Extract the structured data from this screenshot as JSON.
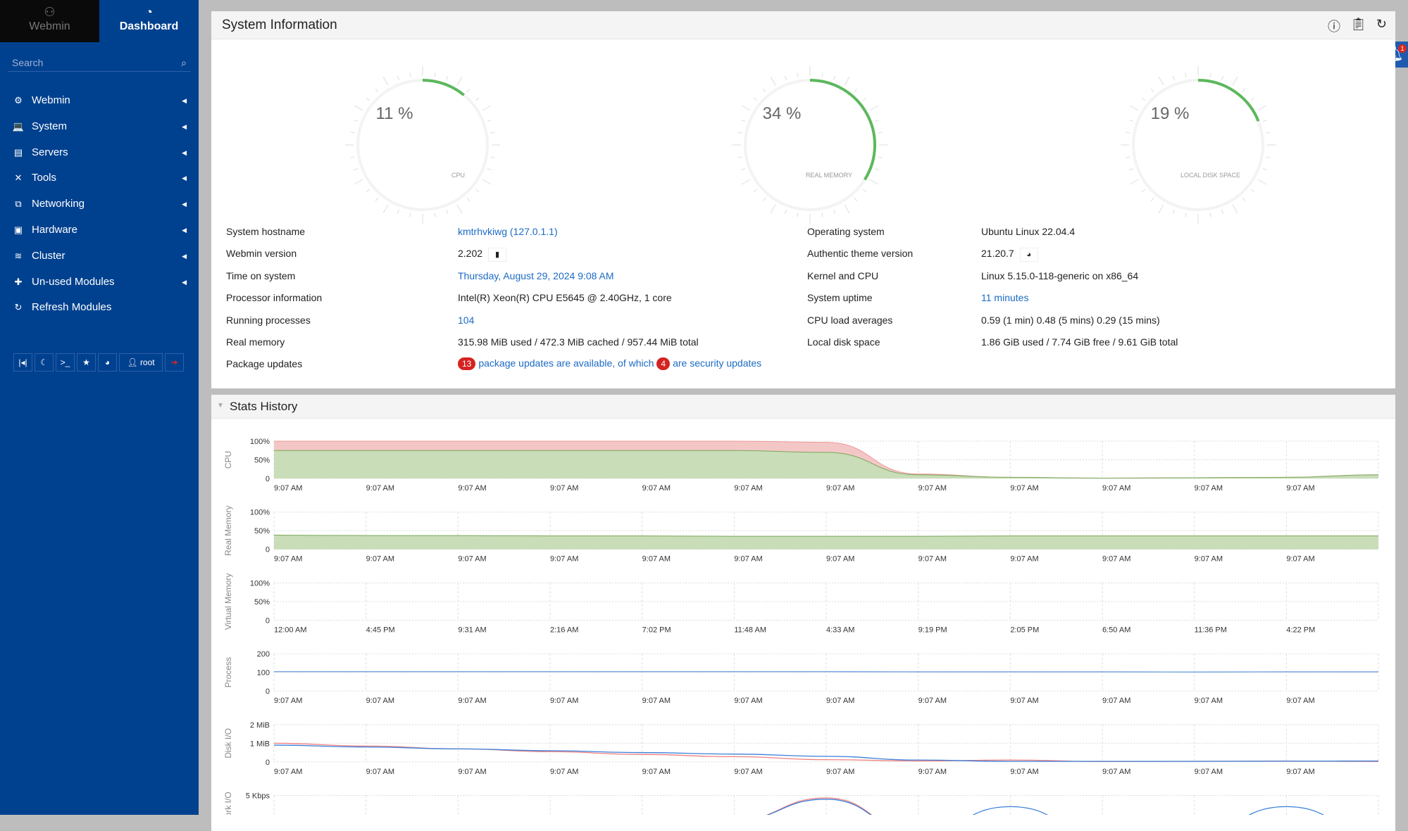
{
  "sidebar": {
    "brand_label": "Webmin",
    "dashboard_label": "Dashboard",
    "search_placeholder": "Search",
    "items": [
      {
        "label": "Webmin",
        "icon": "gear-icon",
        "glyph": "⚙",
        "has_submenu": true
      },
      {
        "label": "System",
        "icon": "laptop-icon",
        "glyph": "💻",
        "has_submenu": true
      },
      {
        "label": "Servers",
        "icon": "server-icon",
        "glyph": "▤",
        "has_submenu": true
      },
      {
        "label": "Tools",
        "icon": "tools-icon",
        "glyph": "✕",
        "has_submenu": true
      },
      {
        "label": "Networking",
        "icon": "network-icon",
        "glyph": "⧉",
        "has_submenu": true
      },
      {
        "label": "Hardware",
        "icon": "hdd-icon",
        "glyph": "▣",
        "has_submenu": true
      },
      {
        "label": "Cluster",
        "icon": "layers-icon",
        "glyph": "≋",
        "has_submenu": true
      },
      {
        "label": "Un-used Modules",
        "icon": "puzzle-icon",
        "glyph": "✚",
        "has_submenu": true
      },
      {
        "label": "Refresh Modules",
        "icon": "refresh-icon",
        "glyph": "↻",
        "has_submenu": false
      }
    ],
    "bottom_buttons": [
      {
        "name": "collapse-button",
        "icon": "collapse-icon",
        "glyph": "|◂|"
      },
      {
        "name": "night-mode-button",
        "icon": "moon-icon",
        "glyph": "☾"
      },
      {
        "name": "terminal-button",
        "icon": "terminal-icon",
        "glyph": ">_"
      },
      {
        "name": "favorites-button",
        "icon": "star-icon",
        "glyph": "★"
      },
      {
        "name": "theme-button",
        "icon": "palette-icon",
        "glyph": "◕"
      },
      {
        "name": "user-button",
        "icon": "user-cog-icon",
        "glyph": "👤 root",
        "label": "root"
      },
      {
        "name": "logout-button",
        "icon": "logout-icon",
        "glyph": "➜",
        "color": "#e0241b"
      }
    ]
  },
  "notifications": {
    "count": "1"
  },
  "system_info": {
    "title": "System Information",
    "header_icons": [
      "help-icon",
      "clipboard-icon",
      "refresh-icon"
    ],
    "gauges": [
      {
        "label": "CPU",
        "percent": 11
      },
      {
        "label": "REAL MEMORY",
        "percent": 34
      },
      {
        "label": "LOCAL DISK SPACE",
        "percent": 19
      }
    ],
    "gauge_color": "#5cb85c",
    "left": [
      {
        "label": "System hostname",
        "value": "kmtrhvkiwg (127.0.1.1)",
        "link": true
      },
      {
        "label": "Webmin version",
        "value": "2.202",
        "icon": "book-icon"
      },
      {
        "label": "Time on system",
        "value": "Thursday, August 29, 2024 9:08 AM",
        "link": true
      },
      {
        "label": "Processor information",
        "value": "Intel(R) Xeon(R) CPU E5645 @ 2.40GHz, 1 core"
      },
      {
        "label": "Running processes",
        "value": "104",
        "link": true
      },
      {
        "label": "Real memory",
        "value": "315.98 MiB used / 472.3 MiB cached / 957.44 MiB total"
      }
    ],
    "package_updates": {
      "label": "Package updates",
      "count": "13",
      "text1": "package updates are available, of which",
      "security_count": "4",
      "text2": "are security updates"
    },
    "right": [
      {
        "label": "Operating system",
        "value": "Ubuntu Linux 22.04.4"
      },
      {
        "label": "Authentic theme version",
        "value": "21.20.7",
        "icon": "palette-icon"
      },
      {
        "label": "Kernel and CPU",
        "value": "Linux 5.15.0-118-generic on x86_64"
      },
      {
        "label": "System uptime",
        "value": "11 minutes",
        "link": true
      },
      {
        "label": "CPU load averages",
        "value": "0.59 (1 min) 0.48 (5 mins) 0.29 (15 mins)"
      },
      {
        "label": "Local disk space",
        "value": "1.86 GiB used / 7.74 GiB free / 9.61 GiB total"
      }
    ]
  },
  "stats_history": {
    "title": "Stats History"
  },
  "chart_data": [
    {
      "type": "area",
      "ylabel": "CPU",
      "yticks": [
        "100%",
        "50%",
        "0"
      ],
      "ylim": [
        0,
        100
      ],
      "grid": true,
      "xticks": [
        "9:07 AM",
        "9:07 AM",
        "9:07 AM",
        "9:07 AM",
        "9:07 AM",
        "9:07 AM",
        "9:07 AM",
        "9:07 AM",
        "9:07 AM",
        "9:07 AM",
        "9:07 AM",
        "9:07 AM"
      ],
      "series": [
        {
          "color": "#f4c7c7",
          "values": [
            100,
            100,
            100,
            100,
            100,
            100,
            97,
            12,
            3,
            1,
            2,
            3,
            10
          ]
        },
        {
          "color": "#c9ddb8",
          "values": [
            75,
            75,
            75,
            75,
            75,
            75,
            70,
            10,
            3,
            1,
            2,
            3,
            10
          ]
        }
      ]
    },
    {
      "type": "area",
      "ylabel": "Real Memory",
      "yticks": [
        "100%",
        "50%",
        "0"
      ],
      "ylim": [
        0,
        100
      ],
      "grid": true,
      "xticks": [
        "9:07 AM",
        "9:07 AM",
        "9:07 AM",
        "9:07 AM",
        "9:07 AM",
        "9:07 AM",
        "9:07 AM",
        "9:07 AM",
        "9:07 AM",
        "9:07 AM",
        "9:07 AM",
        "9:07 AM"
      ],
      "series": [
        {
          "color": "#c9ddb8",
          "values": [
            38,
            37,
            37,
            36,
            36,
            35,
            35,
            35,
            36,
            36,
            36,
            36,
            36
          ]
        }
      ]
    },
    {
      "type": "area",
      "ylabel": "Virtual Memory",
      "yticks": [
        "100%",
        "50%",
        "0"
      ],
      "ylim": [
        0,
        100
      ],
      "grid": true,
      "xticks": [
        "12:00 AM",
        "4:45 PM",
        "9:31 AM",
        "2:16 AM",
        "7:02 PM",
        "11:48 AM",
        "4:33 AM",
        "9:19 PM",
        "2:05 PM",
        "6:50 AM",
        "11:36 PM",
        "4:22 PM"
      ],
      "series": []
    },
    {
      "type": "line",
      "ylabel": "Process",
      "yticks": [
        "200",
        "100",
        "0"
      ],
      "ylim": [
        0,
        200
      ],
      "grid": true,
      "xticks": [
        "9:07 AM",
        "9:07 AM",
        "9:07 AM",
        "9:07 AM",
        "9:07 AM",
        "9:07 AM",
        "9:07 AM",
        "9:07 AM",
        "9:07 AM",
        "9:07 AM",
        "9:07 AM",
        "9:07 AM"
      ],
      "series": [
        {
          "color": "#6e9fe0",
          "values": [
            104,
            104,
            104,
            104,
            104,
            104,
            104,
            103,
            103,
            103,
            102,
            103,
            103
          ]
        }
      ]
    },
    {
      "type": "line",
      "ylabel": "Disk I/O",
      "yticks": [
        "2 MiB",
        "1 MiB",
        "0"
      ],
      "ylim": [
        0,
        2
      ],
      "grid": true,
      "xticks": [
        "9:07 AM",
        "9:07 AM",
        "9:07 AM",
        "9:07 AM",
        "9:07 AM",
        "9:07 AM",
        "9:07 AM",
        "9:07 AM",
        "9:07 AM",
        "9:07 AM",
        "9:07 AM",
        "9:07 AM"
      ],
      "series": [
        {
          "color": "#f08080",
          "values": [
            1.0,
            0.85,
            0.7,
            0.55,
            0.4,
            0.28,
            0.12,
            0.05,
            0.1,
            0.02,
            0.03,
            0.05,
            0.02
          ]
        },
        {
          "color": "#3b7fd9",
          "values": [
            0.9,
            0.8,
            0.7,
            0.6,
            0.5,
            0.42,
            0.3,
            0.1,
            0.03,
            0.03,
            0.03,
            0.04,
            0.05
          ]
        }
      ]
    },
    {
      "type": "line",
      "ylabel": "Network I/O",
      "yticks": [
        "5 Kbps"
      ],
      "ylim": [
        0,
        6
      ],
      "grid": true,
      "xticks": [],
      "series": [
        {
          "color": "#f08080",
          "values": [
            0,
            0,
            0,
            0,
            0,
            2,
            5.6,
            0,
            0,
            0,
            0,
            0,
            0
          ]
        },
        {
          "color": "#3b7fd9",
          "values": [
            0,
            0,
            0,
            0,
            0,
            2,
            5.4,
            0,
            4.2,
            0,
            0,
            4.2,
            0
          ]
        }
      ]
    }
  ]
}
